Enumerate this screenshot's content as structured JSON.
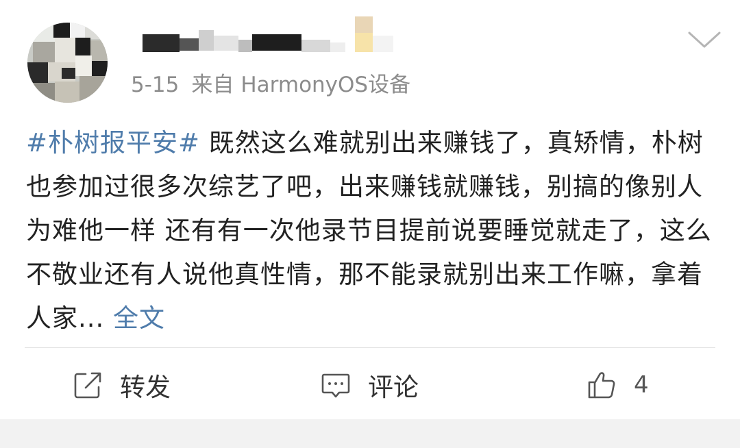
{
  "post": {
    "timestamp": "5-15",
    "source_prefix": "来自",
    "source_device": "HarmonyOS设备",
    "hashtag": "#朴树报平安#",
    "body": " 既然这么难就别出来赚钱了，真矫情，朴树也参加过很多次综艺了吧，出来赚钱就赚钱，别搞的像别人为难他一样 还有有一次他录节目提前说要睡觉就走了，这么不敬业还有人说他真性情，那不能录就别出来工作嘛，拿着人家... ",
    "expand_label": "全文"
  },
  "actions": {
    "repost_label": "转发",
    "comment_label": "评论",
    "like_count": "4"
  },
  "icons": {
    "expand": "chevron-down-icon",
    "repost": "share-square-arrow-icon",
    "comment": "comment-bubble-icon",
    "like": "thumbs-up-icon"
  },
  "colors": {
    "link": "#4f7cab",
    "meta": "#8c8c8c",
    "text": "#222222",
    "divider": "#e3e3e3"
  }
}
